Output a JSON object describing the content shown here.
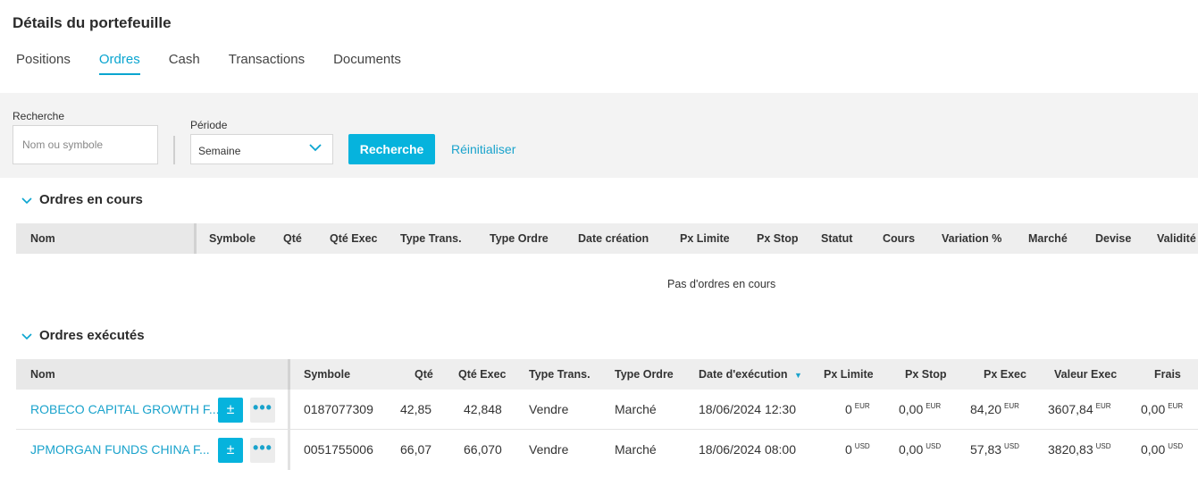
{
  "page_title": "Détails du portefeuille",
  "tabs": [
    {
      "label": "Positions"
    },
    {
      "label": "Ordres"
    },
    {
      "label": "Cash"
    },
    {
      "label": "Transactions"
    },
    {
      "label": "Documents"
    }
  ],
  "active_tab": "Ordres",
  "filters": {
    "search_label": "Recherche",
    "search_placeholder": "Nom ou symbole",
    "period_label": "Période",
    "period_value": "Semaine",
    "search_button": "Recherche",
    "reset_link": "Réinitialiser"
  },
  "pending": {
    "title": "Ordres en cours",
    "columns": [
      "Nom",
      "Symbole",
      "Qté",
      "Qté Exec",
      "Type Trans.",
      "Type Ordre",
      "Date création",
      "Px Limite",
      "Px Stop",
      "Statut",
      "Cours",
      "Variation %",
      "Marché",
      "Devise",
      "Validité"
    ],
    "empty_message": "Pas d'ordres en cours"
  },
  "executed": {
    "title": "Ordres exécutés",
    "columns": [
      "Nom",
      "Symbole",
      "Qté",
      "Qté Exec",
      "Type Trans.",
      "Type Ordre",
      "Date d'exécution",
      "Px Limite",
      "Px Stop",
      "Px Exec",
      "Valeur Exec",
      "Frais"
    ],
    "sort_indicator": "▼",
    "plus_minus_label": "±",
    "more_label": "•••",
    "rows": [
      {
        "nom": "ROBECO CAPITAL GROWTH F...",
        "symbole": "0187077309",
        "qte": "42,85",
        "qte_exec": "42,848",
        "type_trans": "Vendre",
        "type_ordre": "Marché",
        "date": "18/06/2024 12:30",
        "px_limite": "0",
        "px_stop": "0,00",
        "px_exec": "84,20",
        "valeur_exec": "3607,84",
        "frais": "0,00",
        "currency": "EUR"
      },
      {
        "nom": "JPMORGAN FUNDS CHINA F...",
        "symbole": "0051755006",
        "qte": "66,07",
        "qte_exec": "66,070",
        "type_trans": "Vendre",
        "type_ordre": "Marché",
        "date": "18/06/2024 08:00",
        "px_limite": "0",
        "px_stop": "0,00",
        "px_exec": "57,83",
        "valeur_exec": "3820,83",
        "frais": "0,00",
        "currency": "USD"
      }
    ]
  },
  "colors": {
    "accent": "#06b3dd",
    "link": "#1aa3cc",
    "filter_bg": "#f3f3f3",
    "header_bg": "#eeeeee"
  },
  "icons": {
    "period_dropdown": "chevron-down-icon",
    "section_toggle": "chevron-down-icon"
  }
}
